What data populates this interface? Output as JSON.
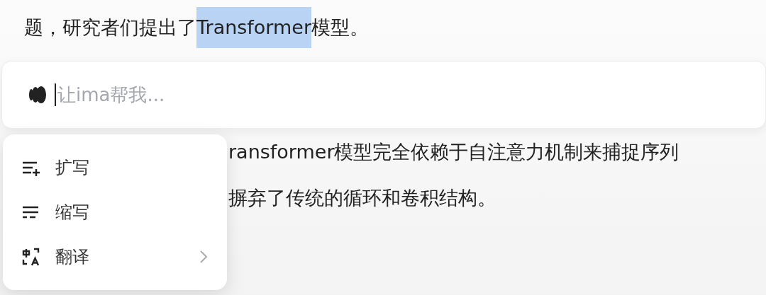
{
  "paragraph": {
    "segments": [
      {
        "text": "题，研究者们提出了",
        "selected": false
      },
      {
        "text": "Transformer",
        "selected": true
      },
      {
        "text": "模型。",
        "selected": false
      }
    ]
  },
  "prompt": {
    "placeholder": "让ima帮我..."
  },
  "list_lines": [
    "ransformer模型完全依赖于自注意力机制来捕捉序列",
    "摒弃了传统的循环和卷积结构。"
  ],
  "menu": {
    "items": [
      {
        "label": "扩写",
        "kind": "expand",
        "submenu": false
      },
      {
        "label": "缩写",
        "kind": "shorten",
        "submenu": false
      },
      {
        "label": "翻译",
        "kind": "translate",
        "submenu": true
      }
    ]
  }
}
